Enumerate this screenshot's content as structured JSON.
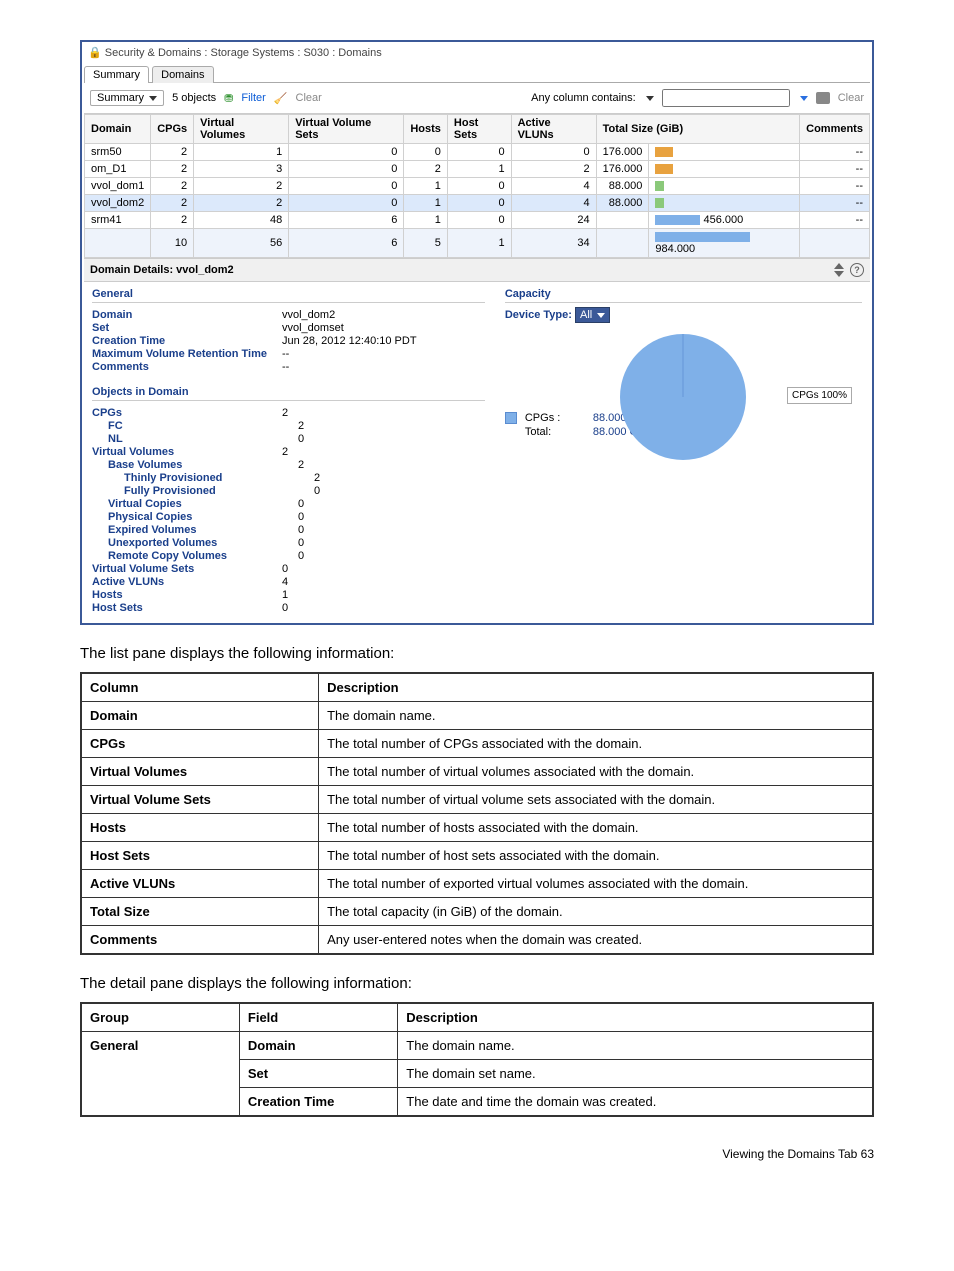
{
  "titlebar": "Security & Domains : Storage Systems : S030 : Domains",
  "tabs": [
    "Summary",
    "Domains"
  ],
  "toolbar": {
    "view": "Summary",
    "count": "5 objects",
    "filter": "Filter",
    "clear": "Clear",
    "search_label": "Any column contains:",
    "print_alt": "Print",
    "clear2": "Clear"
  },
  "grid": {
    "headers": [
      "Domain",
      "CPGs",
      "Virtual Volumes",
      "Virtual Volume Sets",
      "Hosts",
      "Host Sets",
      "Active VLUNs",
      "Total Size (GiB)",
      "",
      "Comments"
    ],
    "rows": [
      {
        "cells": [
          "srm50",
          "2",
          "1",
          "0",
          "0",
          "0",
          "0",
          "176.000"
        ],
        "bar": 18,
        "barColor": "orange",
        "comment": "--"
      },
      {
        "cells": [
          "om_D1",
          "2",
          "3",
          "0",
          "2",
          "1",
          "2",
          "176.000"
        ],
        "bar": 18,
        "barColor": "orange",
        "comment": "--"
      },
      {
        "cells": [
          "vvol_dom1",
          "2",
          "2",
          "0",
          "1",
          "0",
          "4",
          "88.000"
        ],
        "bar": 9,
        "barColor": "green",
        "comment": "--"
      },
      {
        "cells": [
          "vvol_dom2",
          "2",
          "2",
          "0",
          "1",
          "0",
          "4",
          "88.000"
        ],
        "bar": 9,
        "barColor": "green",
        "comment": "--",
        "highlight": true
      },
      {
        "cells": [
          "srm41",
          "2",
          "48",
          "6",
          "1",
          "0",
          "24",
          ""
        ],
        "bar": 45,
        "barColor": "blue",
        "barLabel": "456.000",
        "comment": "--"
      }
    ],
    "totals": {
      "cells": [
        "",
        "10",
        "56",
        "6",
        "5",
        "1",
        "34",
        ""
      ],
      "bar": 95,
      "barLabel": "984.000"
    }
  },
  "details": {
    "title": "Domain Details: vvol_dom2",
    "general_title": "General",
    "capacity_title": "Capacity",
    "fields": [
      {
        "k": "Domain",
        "v": "vvol_dom2"
      },
      {
        "k": "Set",
        "v": "vvol_domset"
      },
      {
        "k": "Creation Time",
        "v": "Jun 28, 2012 12:40:10 PDT"
      },
      {
        "k": "Maximum Volume Retention Time",
        "v": "--"
      },
      {
        "k": "Comments",
        "v": "--"
      }
    ],
    "objects_title": "Objects in Domain",
    "objects": [
      {
        "name": "CPGs",
        "val": "2",
        "indent": 0
      },
      {
        "name": "FC",
        "val": "2",
        "indent": 1
      },
      {
        "name": "NL",
        "val": "0",
        "indent": 1
      },
      {
        "name": "Virtual Volumes",
        "val": "2",
        "indent": 0
      },
      {
        "name": "Base Volumes",
        "val": "2",
        "indent": 1
      },
      {
        "name": "Thinly Provisioned",
        "val": "2",
        "indent": 2
      },
      {
        "name": "Fully Provisioned",
        "val": "0",
        "indent": 2
      },
      {
        "name": "Virtual Copies",
        "val": "0",
        "indent": 1
      },
      {
        "name": "Physical Copies",
        "val": "0",
        "indent": 1
      },
      {
        "name": "Expired Volumes",
        "val": "0",
        "indent": 1
      },
      {
        "name": "Unexported Volumes",
        "val": "0",
        "indent": 1
      },
      {
        "name": "Remote Copy Volumes",
        "val": "0",
        "indent": 1
      },
      {
        "name": "Virtual Volume Sets",
        "val": "0",
        "indent": 0
      },
      {
        "name": "Active VLUNs",
        "val": "4",
        "indent": 0
      },
      {
        "name": "Hosts",
        "val": "1",
        "indent": 0
      },
      {
        "name": "Host Sets",
        "val": "0",
        "indent": 0
      }
    ],
    "device_type_label": "Device Type:",
    "device_type_value": "All",
    "legend": "CPGs\n100%",
    "cap_rows": [
      {
        "label": "CPGs :",
        "value": "88.000 GiB",
        "swatch": true
      },
      {
        "label": "Total:",
        "value": "88.000 GiB",
        "swatch": false
      }
    ]
  },
  "caption1": "The list pane displays the following information:",
  "table1": {
    "headers": [
      "Column",
      "Description"
    ],
    "rows": [
      [
        "Domain",
        "The domain name."
      ],
      [
        "CPGs",
        "The total number of CPGs associated with the domain."
      ],
      [
        "Virtual Volumes",
        "The total number of virtual volumes associated with the domain."
      ],
      [
        "Virtual Volume Sets",
        "The total number of virtual volume sets associated with the domain."
      ],
      [
        "Hosts",
        "The total number of hosts associated with the domain."
      ],
      [
        "Host Sets",
        "The total number of host sets associated with the domain."
      ],
      [
        "Active VLUNs",
        "The total number of exported virtual volumes associated with the domain."
      ],
      [
        "Total Size",
        "The total capacity (in GiB) of the domain."
      ],
      [
        "Comments",
        "Any user-entered notes when the domain was created."
      ]
    ]
  },
  "caption2": "The detail pane displays the following information:",
  "table2": {
    "headers": [
      "Group",
      "Field",
      "Description"
    ],
    "rows": [
      {
        "group": "General",
        "field": "Domain",
        "desc": "The domain name."
      },
      {
        "group": "",
        "field": "Set",
        "desc": "The domain set name."
      },
      {
        "group": "",
        "field": "Creation Time",
        "desc": "The date and time the domain was created."
      }
    ]
  },
  "footer": "Viewing the Domains Tab    63",
  "chart_data": {
    "type": "pie",
    "title": "Capacity",
    "series": [
      {
        "name": "CPGs",
        "value": 88.0,
        "unit": "GiB",
        "percent": 100
      }
    ],
    "total": 88.0,
    "unit": "GiB"
  }
}
